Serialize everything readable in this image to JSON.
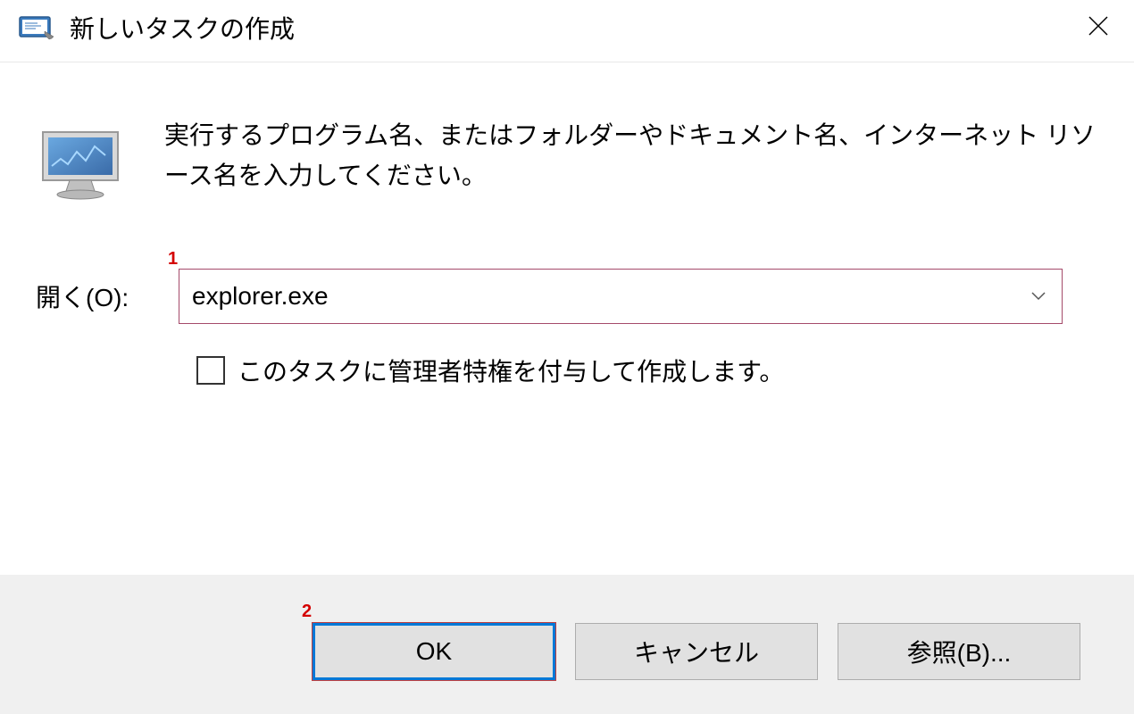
{
  "titlebar": {
    "title": "新しいタスクの作成"
  },
  "content": {
    "description": "実行するプログラム名、またはフォルダーやドキュメント名、インターネット リソース名を入力してください。",
    "open_label": "開く(O):",
    "input_value": "explorer.exe",
    "admin_checkbox_label": "このタスクに管理者特権を付与して作成します。"
  },
  "buttons": {
    "ok": "OK",
    "cancel": "キャンセル",
    "browse": "参照(B)..."
  },
  "annotations": {
    "marker1": "1",
    "marker2": "2"
  }
}
